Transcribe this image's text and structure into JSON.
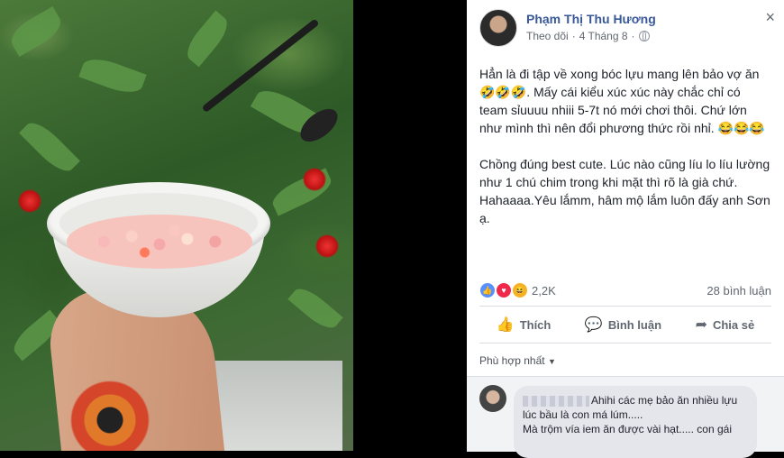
{
  "post": {
    "author": "Phạm Thị Thu Hương",
    "follow_label": "Theo dõi",
    "dot": "·",
    "date": "4 Tháng 8",
    "privacy_icon": "globe-icon",
    "close_icon": "×",
    "paragraphs": [
      "Hẳn là đi tập về xong bóc lựu mang lên bảo vợ ăn 🤣🤣🤣. Mấy cái kiểu xúc xúc này chắc chỉ có team sỉuuuu nhiii 5-7t nó mới chơi thôi. Chứ lớn như mình thì nên đổi phương thức rồi nhỉ. 😂😂😂",
      "Chồng đúng best cute. Lúc nào cũng líu lo líu lường như 1 chú chim trong khi mặt thì rõ là già chứ. Hahaaaa.Yêu lắmm, hâm mộ lắm luôn đấy anh Sơn ạ."
    ],
    "reactions_count": "2,2K",
    "comments_count": "28 bình luận",
    "actions": {
      "like": "Thích",
      "comment": "Bình luận",
      "share": "Chia sẻ"
    },
    "sort_label": "Phù hợp nhất",
    "colors": {
      "name": "#385898",
      "like": "#5890ff",
      "love": "#f0284a",
      "haha": "#f7b125"
    }
  },
  "comment": {
    "line1": "Ahihi các mẹ bảo ăn nhiều lựu",
    "line2": "lúc bầu là con má lúm.....",
    "line3": "Mà trộm vía iem ăn được vài hạt..... con gái"
  }
}
